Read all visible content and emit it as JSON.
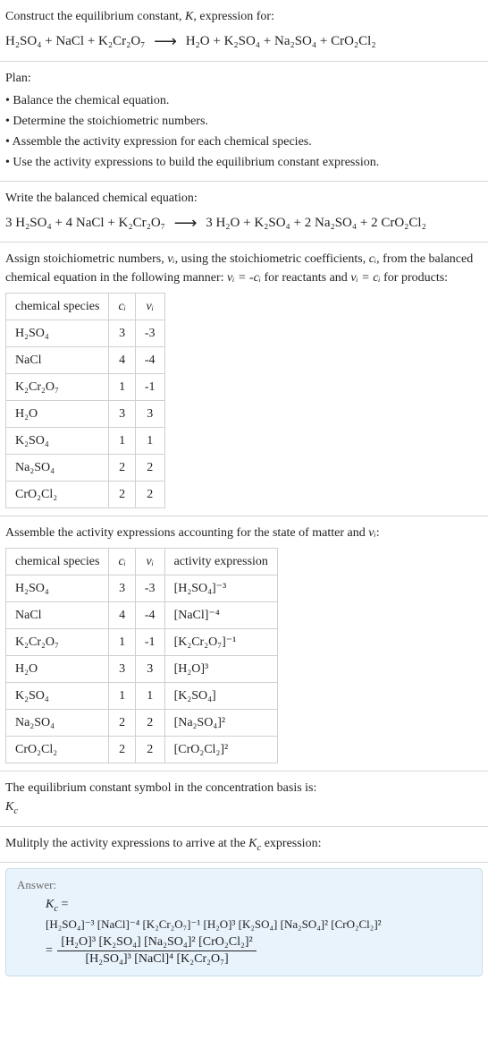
{
  "top": {
    "prompt_1": "Construct the equilibrium constant, ",
    "K": "K",
    "prompt_2": ", expression for:",
    "reaction_lhs": "H₂SO₄ + NaCl + K₂Cr₂O₇",
    "reaction_rhs": "H₂O + K₂SO₄ + Na₂SO₄ + CrO₂Cl₂"
  },
  "plan": {
    "title": "Plan:",
    "items": [
      "• Balance the chemical equation.",
      "• Determine the stoichiometric numbers.",
      "• Assemble the activity expression for each chemical species.",
      "• Use the activity expressions to build the equilibrium constant expression."
    ]
  },
  "balanced": {
    "intro": "Write the balanced chemical equation:",
    "lhs": "3 H₂SO₄ + 4 NaCl + K₂Cr₂O₇",
    "rhs": "3 H₂O + K₂SO₄ + 2 Na₂SO₄ + 2 CrO₂Cl₂"
  },
  "stoich": {
    "intro_1": "Assign stoichiometric numbers, ",
    "nu_i": "νᵢ",
    "intro_2": ", using the stoichiometric coefficients, ",
    "c_i": "cᵢ",
    "intro_3": ", from the balanced chemical equation in the following manner: ",
    "rel1": "νᵢ = -cᵢ",
    "intro_4": " for reactants and ",
    "rel2": "νᵢ = cᵢ",
    "intro_5": " for products:",
    "head": [
      "chemical species",
      "cᵢ",
      "νᵢ"
    ],
    "rows": [
      {
        "sp": "H₂SO₄",
        "c": "3",
        "nu": "-3"
      },
      {
        "sp": "NaCl",
        "c": "4",
        "nu": "-4"
      },
      {
        "sp": "K₂Cr₂O₇",
        "c": "1",
        "nu": "-1"
      },
      {
        "sp": "H₂O",
        "c": "3",
        "nu": "3"
      },
      {
        "sp": "K₂SO₄",
        "c": "1",
        "nu": "1"
      },
      {
        "sp": "Na₂SO₄",
        "c": "2",
        "nu": "2"
      },
      {
        "sp": "CrO₂Cl₂",
        "c": "2",
        "nu": "2"
      }
    ]
  },
  "activity": {
    "intro_1": "Assemble the activity expressions accounting for the state of matter and ",
    "nu_i": "νᵢ",
    "intro_2": ":",
    "head": [
      "chemical species",
      "cᵢ",
      "νᵢ",
      "activity expression"
    ],
    "rows": [
      {
        "sp": "H₂SO₄",
        "c": "3",
        "nu": "-3",
        "act": "[H₂SO₄]⁻³"
      },
      {
        "sp": "NaCl",
        "c": "4",
        "nu": "-4",
        "act": "[NaCl]⁻⁴"
      },
      {
        "sp": "K₂Cr₂O₇",
        "c": "1",
        "nu": "-1",
        "act": "[K₂Cr₂O₇]⁻¹"
      },
      {
        "sp": "H₂O",
        "c": "3",
        "nu": "3",
        "act": "[H₂O]³"
      },
      {
        "sp": "K₂SO₄",
        "c": "1",
        "nu": "1",
        "act": "[K₂SO₄]"
      },
      {
        "sp": "Na₂SO₄",
        "c": "2",
        "nu": "2",
        "act": "[Na₂SO₄]²"
      },
      {
        "sp": "CrO₂Cl₂",
        "c": "2",
        "nu": "2",
        "act": "[CrO₂Cl₂]²"
      }
    ]
  },
  "kcsymbol": {
    "line1": "The equilibrium constant symbol in the concentration basis is:",
    "kc": "K",
    "kc_sub": "c"
  },
  "multiply": {
    "line_1": "Mulitply the activity expressions to arrive at the ",
    "kc": "K",
    "kc_sub": "c",
    "line_2": " expression:"
  },
  "answer": {
    "label": "Answer:",
    "kc": "K",
    "kc_sub": "c",
    "eq": " = ",
    "first_line": "[H₂SO₄]⁻³ [NaCl]⁻⁴ [K₂Cr₂O₇]⁻¹ [H₂O]³ [K₂SO₄] [Na₂SO₄]² [CrO₂Cl₂]²",
    "frac_num": "[H₂O]³ [K₂SO₄] [Na₂SO₄]² [CrO₂Cl₂]²",
    "frac_den": "[H₂SO₄]³ [NaCl]⁴ [K₂Cr₂O₇]",
    "eq2": "= "
  }
}
